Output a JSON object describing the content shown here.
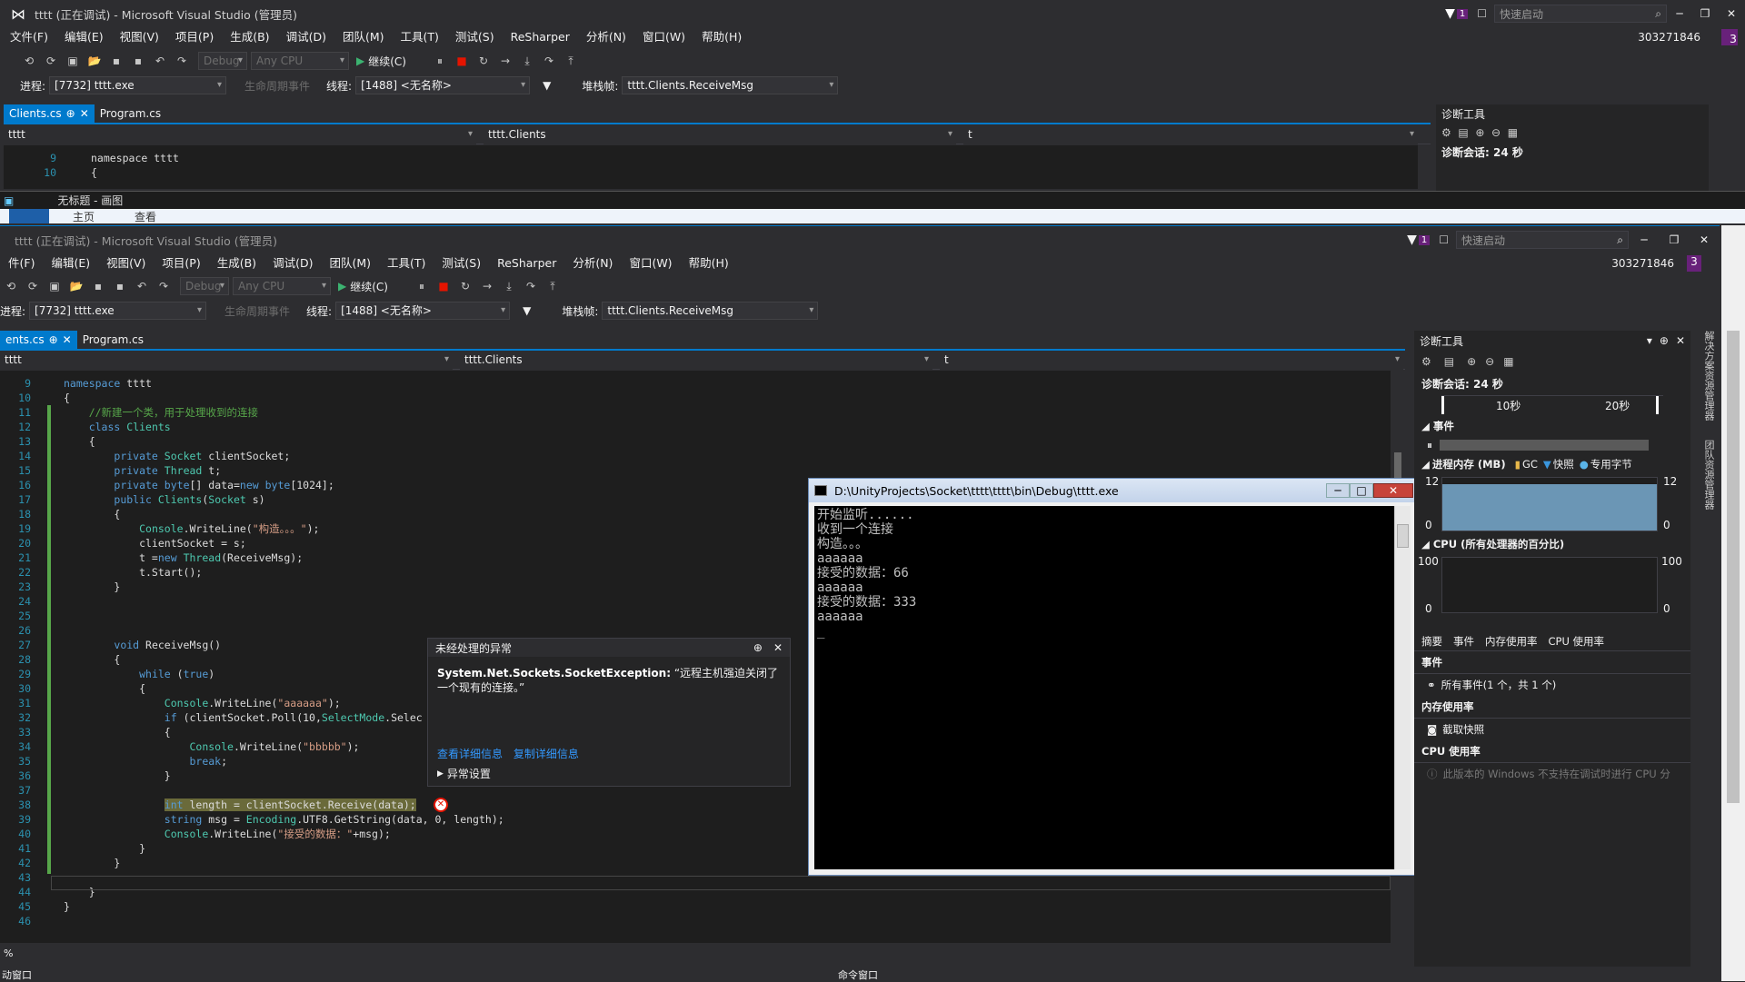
{
  "back_window": {
    "title": "tttt (正在调试) - Microsoft Visual Studio (管理员)",
    "quick_launch": "快速启动",
    "notif_count": "1",
    "account": "303271846",
    "menu": [
      "文件(F)",
      "编辑(E)",
      "视图(V)",
      "项目(P)",
      "生成(B)",
      "调试(D)",
      "团队(M)",
      "工具(T)",
      "测试(S)",
      "ReSharper",
      "分析(N)",
      "窗口(W)",
      "帮助(H)"
    ],
    "toolbar": {
      "config": "Debug",
      "platform": "Any CPU",
      "continue": "继续(C)"
    },
    "debug_bar": {
      "process_label": "进程:",
      "process": "[7732] tttt.exe",
      "lifecycle": "生命周期事件",
      "thread_label": "线程:",
      "thread": "[1488] <无名称>",
      "stack_label": "堆栈帧:",
      "stack": "tttt.Clients.ReceiveMsg"
    },
    "tabs": [
      "Clients.cs",
      "Program.cs"
    ],
    "nav": {
      "project": "tttt",
      "class": "tttt.Clients",
      "member": "t"
    },
    "code_lines": [
      {
        "n": "9",
        "t": "namespace tttt"
      },
      {
        "n": "10",
        "t": "{"
      },
      {
        "n": "11",
        "t": "    //新建一个类，用于处理收到的连接"
      }
    ],
    "diag": {
      "title": "诊断工具",
      "session": "诊断会话: 24 秒",
      "t1": "10秒",
      "t2": "20秒"
    }
  },
  "taskbar": {
    "label": "无标题 - 画图",
    "tab1": "主页",
    "tab2": "查看"
  },
  "front_window": {
    "title": "tttt (正在调试) - Microsoft Visual Studio (管理员)",
    "quick_launch": "快速启动",
    "notif_count": "1",
    "account": "303271846",
    "menu": [
      "件(F)",
      "编辑(E)",
      "视图(V)",
      "项目(P)",
      "生成(B)",
      "调试(D)",
      "团队(M)",
      "工具(T)",
      "测试(S)",
      "ReSharper",
      "分析(N)",
      "窗口(W)",
      "帮助(H)"
    ],
    "toolbar": {
      "config": "Debug",
      "platform": "Any CPU",
      "continue": "继续(C)"
    },
    "debug_bar": {
      "process_label": "进程:",
      "process": "[7732] tttt.exe",
      "lifecycle": "生命周期事件",
      "thread_label": "线程:",
      "thread": "[1488] <无名称>",
      "stack_label": "堆栈帧:",
      "stack": "tttt.Clients.ReceiveMsg"
    },
    "tabs": [
      "ents.cs",
      "Program.cs"
    ],
    "nav": {
      "project": "tttt",
      "class": "tttt.Clients",
      "member": "t"
    },
    "zoom": "%"
  },
  "code": [
    {
      "n": "9",
      "h": "<span class='kw'>namespace</span> tttt"
    },
    {
      "n": "10",
      "h": "{"
    },
    {
      "n": "11",
      "h": "    <span class='cm'>//新建一个类，用于处理收到的连接</span>"
    },
    {
      "n": "12",
      "h": "    <span class='kw'>class</span> <span class='ty'>Clients</span>"
    },
    {
      "n": "13",
      "h": "    {"
    },
    {
      "n": "14",
      "h": "        <span class='kw'>private</span> <span class='ty'>Socket</span> clientSocket;"
    },
    {
      "n": "15",
      "h": "        <span class='kw'>private</span> <span class='ty'>Thread</span> t;"
    },
    {
      "n": "16",
      "h": "        <span class='kw'>private</span> <span class='kw'>byte</span>[] data=<span class='kw'>new</span> <span class='kw'>byte</span>[1024];"
    },
    {
      "n": "17",
      "h": "        <span class='kw'>public</span> <span class='ty'>Clients</span>(<span class='ty'>Socket</span> s)"
    },
    {
      "n": "18",
      "h": "        {"
    },
    {
      "n": "19",
      "h": "            <span class='ty'>Console</span>.WriteLine(<span class='st'>\"构造。。。\"</span>);"
    },
    {
      "n": "20",
      "h": "            clientSocket = s;"
    },
    {
      "n": "21",
      "h": "            t =<span class='kw'>new</span> <span class='ty'>Thread</span>(ReceiveMsg);"
    },
    {
      "n": "22",
      "h": "            t.Start();"
    },
    {
      "n": "23",
      "h": "        }"
    },
    {
      "n": "24",
      "h": ""
    },
    {
      "n": "25",
      "h": ""
    },
    {
      "n": "26",
      "h": ""
    },
    {
      "n": "27",
      "h": "        <span class='kw'>void</span> ReceiveMsg()"
    },
    {
      "n": "28",
      "h": "        {"
    },
    {
      "n": "29",
      "h": "            <span class='kw'>while</span> (<span class='kw'>true</span>)"
    },
    {
      "n": "30",
      "h": "            {"
    },
    {
      "n": "31",
      "h": "                <span class='ty'>Console</span>.WriteLine(<span class='st'>\"aaaaaa\"</span>);"
    },
    {
      "n": "32",
      "h": "                <span class='kw'>if</span> (clientSocket.Poll(10,<span class='ty'>SelectMode</span>.Selec"
    },
    {
      "n": "33",
      "h": "                {"
    },
    {
      "n": "34",
      "h": "                    <span class='ty'>Console</span>.WriteLine(<span class='st'>\"bbbbb\"</span>);"
    },
    {
      "n": "35",
      "h": "                    <span class='kw'>break</span>;"
    },
    {
      "n": "36",
      "h": "                }"
    },
    {
      "n": "37",
      "h": ""
    },
    {
      "n": "38",
      "h": "                <span style='background:#6a6a3a'><span class='kw'>int</span> length = clientSocket.Receive(data);</span>"
    },
    {
      "n": "39",
      "h": "                <span class='kw'>string</span> msg = <span class='ty'>Encoding</span>.UTF8.GetString(data, 0, length);"
    },
    {
      "n": "40",
      "h": "                <span class='ty'>Console</span>.WriteLine(<span class='st'>\"接受的数据：\"</span>+msg);"
    },
    {
      "n": "41",
      "h": "            }"
    },
    {
      "n": "42",
      "h": "        }"
    },
    {
      "n": "43",
      "h": ""
    },
    {
      "n": "44",
      "h": "    }"
    },
    {
      "n": "45",
      "h": "}"
    },
    {
      "n": "46",
      "h": ""
    }
  ],
  "exception": {
    "title": "未经处理的异常",
    "type": "System.Net.Sockets.SocketException:",
    "msg": "“远程主机强迫关闭了一个现有的连接。”",
    "link1": "查看详细信息",
    "link2": "复制详细信息",
    "settings": "异常设置"
  },
  "console": {
    "title": "D:\\UnityProjects\\Socket\\tttt\\tttt\\bin\\Debug\\tttt.exe",
    "lines": [
      "开始监听......",
      "收到一个连接",
      "构造。。。",
      "aaaaaa",
      "接受的数据：66",
      "aaaaaa",
      "接受的数据：333",
      "aaaaaa",
      "_"
    ]
  },
  "diagnostics": {
    "title": "诊断工具",
    "session": "诊断会话: 24 秒",
    "t1": "10秒",
    "t2": "20秒",
    "events_header": "事件",
    "memory_header": "进程内存 (MB)",
    "legend": [
      "GC",
      "快照",
      "专用字节"
    ],
    "mem_max": "12",
    "mem_min": "0",
    "cpu_header": "CPU (所有处理器的百分比)",
    "cpu_max": "100",
    "cpu_min": "0",
    "tabs": [
      "摘要",
      "事件",
      "内存使用率",
      "CPU 使用率"
    ],
    "sec_events": "事件",
    "all_events": "所有事件(1 个，共 1 个)",
    "sec_mem": "内存使用率",
    "snapshot": "截取快照",
    "sec_cpu": "CPU 使用率",
    "cpu_note": "此版本的 Windows 不支持在调试时进行 CPU 分"
  },
  "side_tabs": [
    "解决方案资源管理器",
    "团队资源管理器"
  ],
  "bottom": {
    "left": "动窗口",
    "right": "命令窗口"
  },
  "colors": {
    "accent": "#007acc",
    "bg": "#2d2d30",
    "editor": "#1e1e1e",
    "vs_badge": "#68217a"
  }
}
